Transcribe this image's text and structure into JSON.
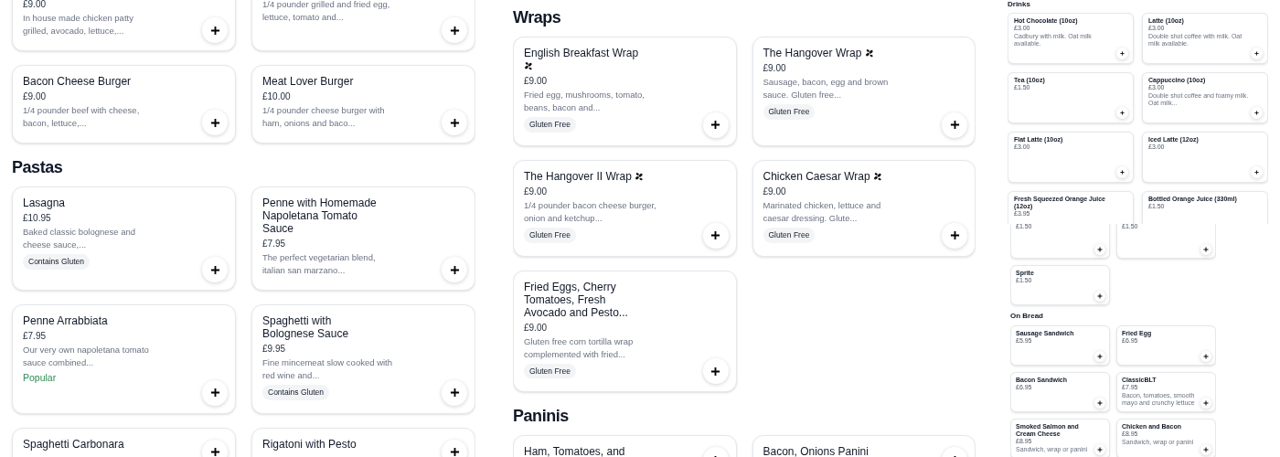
{
  "panels": [
    {
      "kind": "large",
      "sections": [
        {
          "items": [
            {
              "price": "£9.00",
              "description": "In house made chicken patty grilled, avocado, lettuce,..."
            },
            {
              "description": "1/4 pounder grilled and fried egg, lettuce, tomato and..."
            },
            {
              "title": "Bacon Cheese Burger",
              "price": "£9.00",
              "description": "1/4 pounder beef with cheese, bacon, lettuce,..."
            },
            {
              "title": "Meat Lover Burger",
              "price": "£10.00",
              "description": "1/4 pounder cheese burger with ham, onions and baco..."
            }
          ]
        },
        {
          "heading": "Pastas",
          "items": [
            {
              "title": "Lasagna",
              "price": "£10.95",
              "description": "Baked classic bolognese and cheese sauce,...",
              "badge": {
                "kind": "tag",
                "text": "Contains Gluten"
              }
            },
            {
              "title": "Penne with Homemade Napoletana Tomato Sauce",
              "price": "£7.95",
              "description": "The perfect vegetarian blend, italian san marzano..."
            },
            {
              "title": "Penne Arrabbiata",
              "price": "£7.95",
              "description": "Our very own napoletana tomato sauce combined...",
              "badge": {
                "kind": "popular",
                "text": "Popular"
              }
            },
            {
              "title": "Spaghetti with Bolognese Sauce",
              "price": "£9.95",
              "description": "Fine mincemeat slow cooked with red wine and...",
              "badge": {
                "kind": "tag",
                "text": "Contains Gluten"
              }
            },
            {
              "title": "Spaghetti Carbonara"
            },
            {
              "title": "Rigatoni with Pesto"
            }
          ]
        }
      ]
    },
    {
      "kind": "large",
      "sections": [
        {
          "heading": "Wraps",
          "items": [
            {
              "title": "English Breakfast Wrap",
              "vegetarian": true,
              "price": "£9.00",
              "description": "Fried egg, mushrooms, tomato, beans, bacon and...",
              "badge": {
                "kind": "tag",
                "text": "Gluten Free"
              }
            },
            {
              "title": "The Hangover Wrap",
              "vegetarian": true,
              "price": "£9.00",
              "description": "Sausage, bacon, egg and brown sauce. Gluten free...",
              "badge": {
                "kind": "tag",
                "text": "Gluten Free"
              }
            },
            {
              "title": "The Hangover II Wrap",
              "vegetarian": true,
              "price": "£9.00",
              "description": "1/4 pounder bacon cheese burger, onion and ketchup...",
              "badge": {
                "kind": "tag",
                "text": "Gluten Free"
              }
            },
            {
              "title": "Chicken Caesar Wrap",
              "vegetarian": true,
              "price": "£9.00",
              "description": "Marinated chicken, lettuce and caesar dressing. Glute...",
              "badge": {
                "kind": "tag",
                "text": "Gluten Free"
              }
            },
            {
              "title": "Fried Eggs, Cherry Tomatoes, Fresh Avocado and Pesto...",
              "price": "£9.00",
              "description": "Gluten free corn tortilla wrap complemented with fried...",
              "badge": {
                "kind": "tag",
                "text": "Gluten Free"
              }
            }
          ]
        },
        {
          "heading": "Paninis",
          "items": [
            {
              "title": "Ham, Tomatoes, and"
            },
            {
              "title": "Bacon, Onions Panini"
            }
          ]
        }
      ]
    },
    {
      "kind": "small",
      "sections": [
        {
          "heading": "Drinks",
          "items": [
            {
              "title": "Hot Chocolate (10oz)",
              "price": "£3.00",
              "description": "Cadbury with milk. Oat milk available."
            },
            {
              "title": "Latte (10oz)",
              "price": "£3.00",
              "description": "Double shot coffee with milk. Oat milk available."
            },
            {
              "title": "Tea (10oz)",
              "price": "£1.50"
            },
            {
              "title": "Cappuccino (10oz)",
              "price": "£3.00",
              "description": "Double shot coffee and foamy milk. Oat milk..."
            },
            {
              "title": "Flat Latte (10oz)",
              "price": "£3.00"
            },
            {
              "title": "Iced Latte (12oz)",
              "price": "£3.00"
            },
            {
              "title": "Fresh Squeezed Orange Juice (12oz)",
              "price": "£3.95"
            },
            {
              "title": "Bottled Orange Juice (330ml)",
              "price": "£1.50"
            }
          ]
        }
      ]
    },
    {
      "kind": "tiny",
      "sections": [
        {
          "items": [
            {
              "price": "£1.50"
            },
            {
              "price": "£1.50"
            },
            {
              "title": "Sprite",
              "price": "£1.50"
            }
          ]
        },
        {
          "heading": "On Bread",
          "items": [
            {
              "title": "Sausage Sandwich",
              "price": "£5.95"
            },
            {
              "title": "Fried Egg",
              "price": "£6.95"
            },
            {
              "title": "Bacon Sandwich",
              "price": "£6.95"
            },
            {
              "title": "ClassicBLT",
              "price": "£7.95",
              "description": "Bacon, tomatoes, smooth mayo and crunchy lettuce"
            },
            {
              "title": "Smoked Salmon and Cream Cheese",
              "price": "£8.95",
              "description": "Sandwich, wrap or panini"
            },
            {
              "title": "Chicken and Bacon",
              "price": "£8.95",
              "description": "Sandwich, wrap or panini"
            }
          ]
        }
      ]
    }
  ]
}
